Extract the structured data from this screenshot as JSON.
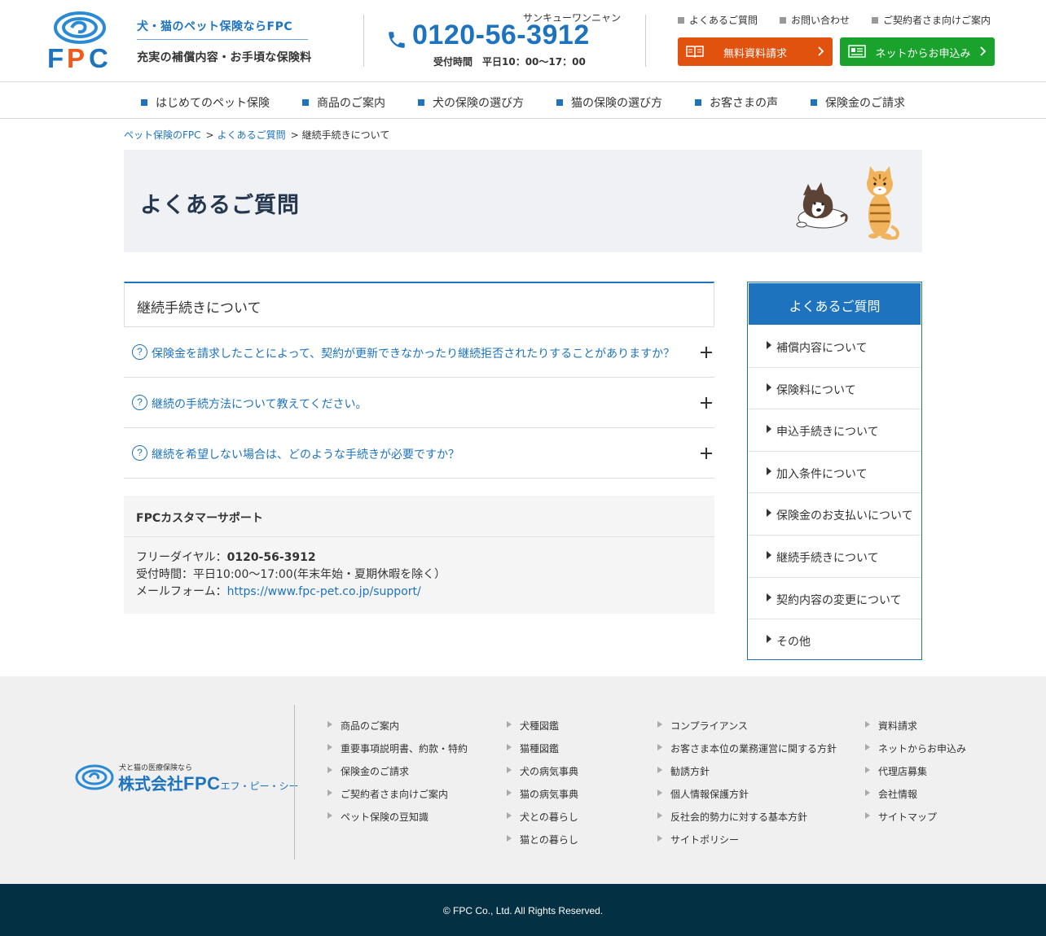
{
  "header": {
    "logo_text": "FPC",
    "tagline1": "犬・猫のペット保険ならFPC",
    "tagline2": "充実の補償内容・お手頃な保険料",
    "phone_kana": "サンキューワンニャン",
    "phone_number": "0120-56-3912",
    "phone_hours": "受付時間　平日10：00〜17：00",
    "top_links": [
      "よくあるご質問",
      "お問い合わせ",
      "ご契約者さま向けご案内"
    ],
    "btn_brochure": "無料資料請求",
    "btn_apply": "ネットからお申込み",
    "colors": {
      "brand_blue": "#1e73be",
      "orange": "#e0520d",
      "green": "#1aa32c",
      "footer_dark": "#043044"
    }
  },
  "nav": [
    "はじめてのペット保険",
    "商品のご案内",
    "犬の保険の選び方",
    "猫の保険の選び方",
    "お客さまの声",
    "保険金のご請求"
  ],
  "breadcrumb": {
    "home": "ペット保険のFPC",
    "faq": "よくあるご質問",
    "current": "継続手続きについて",
    "sep": ">"
  },
  "banner": {
    "title": "よくあるご質問"
  },
  "faq": {
    "heading": "継続手続きについて",
    "q_mark": "?",
    "questions": [
      "保険金を請求したことによって、契約が更新できなかったり継続拒否されたりすることがありますか？",
      "継続の手続方法について教えてください。",
      "継続を希望しない場合は、どのような手続きが必要ですか？"
    ]
  },
  "support": {
    "title": "FPCカスタマーサポート",
    "dial_label": "フリーダイヤル：",
    "dial_number": "0120-56-3912",
    "hours": "受付時間：平日10:00～17:00(年末年始・夏期休暇を除く）",
    "mail_label": "メールフォーム：",
    "mail_url": "https://www.fpc-pet.co.jp/support/"
  },
  "sidebar": {
    "heading": "よくあるご質問",
    "items": [
      "補償内容について",
      "保険料について",
      "申込手続きについて",
      "加入条件について",
      "保険金のお支払いについて",
      "継続手続きについて",
      "契約内容の変更について",
      "その他"
    ]
  },
  "footer": {
    "logo_small": "犬と猫の医療保険なら",
    "logo_company": "株式会社",
    "logo_fpc": "FPC",
    "logo_kana": "エフ・ピー・シー",
    "col1": [
      "商品のご案内",
      "重要事項説明書、約款・特約",
      "保険金のご請求",
      "ご契約者さま向けご案内",
      "ペット保険の豆知識"
    ],
    "col2": [
      "犬種図鑑",
      "猫種図鑑",
      "犬の病気事典",
      "猫の病気事典",
      "犬との暮らし",
      "猫との暮らし"
    ],
    "col3": [
      "コンプライアンス",
      "お客さま本位の業務運営に関する方針",
      "勧誘方針",
      "個人情報保護方針",
      "反社会的勢力に対する基本方針",
      "サイトポリシー"
    ],
    "col4": [
      "資料請求",
      "ネットからお申込み",
      "代理店募集",
      "会社情報",
      "サイトマップ"
    ],
    "copyright": "© FPC Co., Ltd. All Rights Reserved."
  }
}
